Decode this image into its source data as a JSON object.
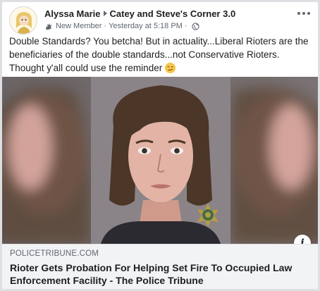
{
  "post": {
    "author": "Alyssa Marie",
    "group": "Catey and Steve's Corner 3.0",
    "badge": "New Member",
    "timestamp": "Yesterday at 5:18 PM",
    "text_main": "Double Standards? You betcha! But in actuality...Liberal Rioters are the beneficiaries of the double standards...not Conservative Rioters. Thought y'all could use the reminder ",
    "icons": {
      "avatar": "avatar-image",
      "badge": "new-member-icon",
      "privacy": "globe-icon",
      "more": "more-options-icon",
      "emoji": "smirk-emoji-icon",
      "info": "info-icon"
    }
  },
  "link_preview": {
    "domain": "POLICETRIBUNE.COM",
    "title": "Rioter Gets Probation For Helping Set Fire To Occupied Law Enforcement Facility - The Police Tribune",
    "info_label": "i"
  },
  "colors": {
    "text_primary": "#1c1e21",
    "text_secondary": "#606770",
    "link_box_bg": "#f2f3f5",
    "border": "#dddfe2"
  }
}
